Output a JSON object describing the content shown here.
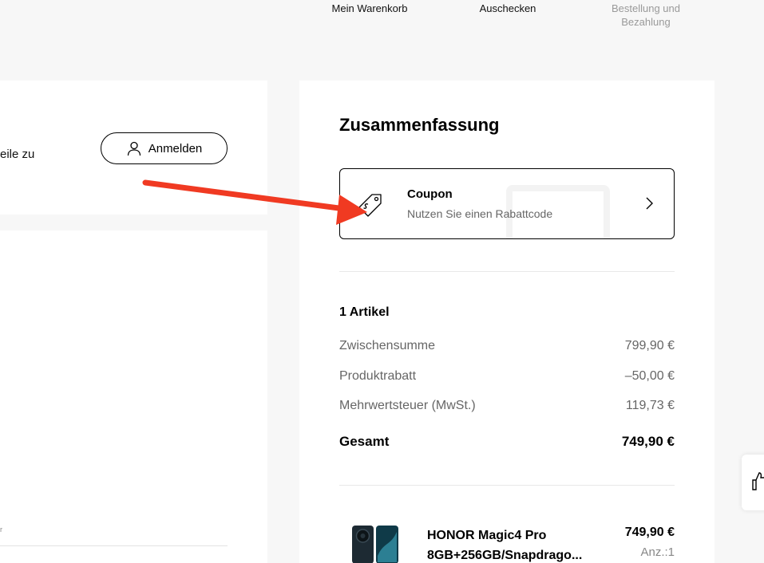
{
  "steps": [
    {
      "label": "Mein Warenkorb"
    },
    {
      "label": "Auschecken"
    },
    {
      "label": "Bestellung und Bezahlung"
    }
  ],
  "left": {
    "cut_text": "eile zu",
    "login_label": "Anmelden",
    "tiny_text": "r"
  },
  "summary": {
    "title": "Zusammenfassung",
    "coupon": {
      "title": "Coupon",
      "subtitle": "Nutzen Sie einen Rabattcode",
      "icon": "tag-icon"
    },
    "items_count": "1 Artikel",
    "lines": [
      {
        "label": "Zwischensumme",
        "value": "799,90 €"
      },
      {
        "label": "Produktrabatt",
        "value": "–50,00 €"
      },
      {
        "label": "Mehrwertsteuer (MwSt.)",
        "value": "119,73 €"
      }
    ],
    "total": {
      "label": "Gesamt",
      "value": "749,90 €"
    }
  },
  "product": {
    "name_line1": "HONOR Magic4 Pro",
    "name_line2": "8GB+256GB/Snapdrago...",
    "price": "749,90 €",
    "qty": "Anz.:1"
  },
  "colors": {
    "accent_arrow": "#f03a22",
    "muted": "#666666",
    "inactive_step": "#9a9a9a"
  }
}
